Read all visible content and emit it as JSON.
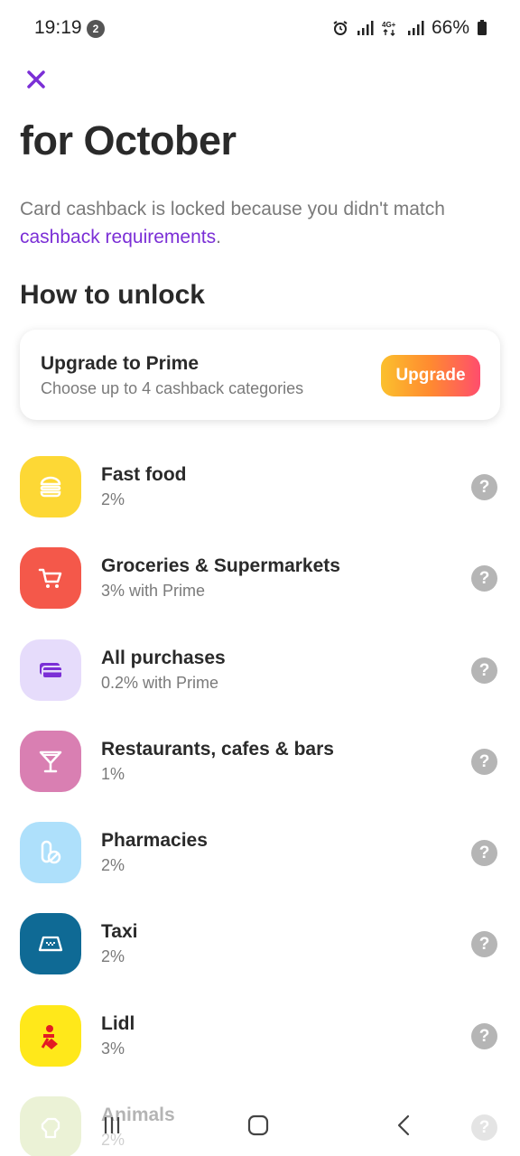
{
  "status_bar": {
    "time": "19:19",
    "notification_count": "2",
    "battery": "66%"
  },
  "header": {
    "title": "for October"
  },
  "description": {
    "text": "Card cashback is locked because you didn't match ",
    "link": "cashback requirements",
    "suffix": "."
  },
  "section": {
    "title": "How to unlock"
  },
  "prime": {
    "title": "Upgrade to Prime",
    "subtitle": "Choose up to 4 cashback categories",
    "button": "Upgrade"
  },
  "categories": [
    {
      "name": "Fast food",
      "rate": "2%",
      "icon": "burger-icon",
      "color": "#fdd835"
    },
    {
      "name": "Groceries & Supermarkets",
      "rate": "3% with Prime",
      "icon": "cart-icon",
      "color": "#f4584a"
    },
    {
      "name": "All purchases",
      "rate": "0.2% with Prime",
      "icon": "cards-icon",
      "color": "#e6dcfb"
    },
    {
      "name": "Restaurants, cafes & bars",
      "rate": "1%",
      "icon": "cocktail-icon",
      "color": "#d97fb2"
    },
    {
      "name": "Pharmacies",
      "rate": "2%",
      "icon": "pills-icon",
      "color": "#aee0fb"
    },
    {
      "name": "Taxi",
      "rate": "2%",
      "icon": "taxi-icon",
      "color": "#0f6a95"
    },
    {
      "name": "Lidl",
      "rate": "3%",
      "icon": "lidl-icon",
      "color": "#ffe81a"
    },
    {
      "name": "Animals",
      "rate": "2%",
      "icon": "pet-icon",
      "color": "#c8dc8c"
    }
  ],
  "colors": {
    "accent": "#7b2fd6",
    "help": "#b5b5b5"
  }
}
